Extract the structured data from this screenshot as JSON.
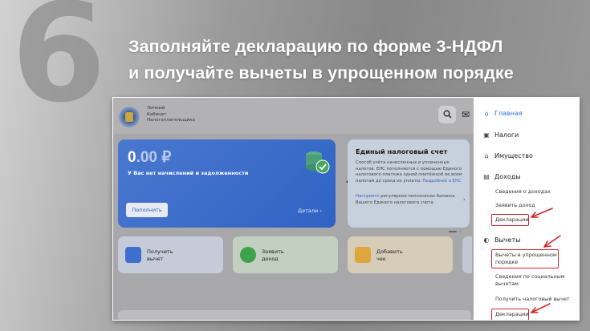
{
  "slide": {
    "number": "6",
    "headline_line1": "Заполняйте декларацию по форме 3-НДФЛ",
    "headline_line2": "и получайте вычеты в упрощенном порядке"
  },
  "header": {
    "cabinet_line1": "Личный",
    "cabinet_line2": "Кабинет",
    "cabinet_line3": "Налогоплательщика",
    "search_icon": "search-icon",
    "mail_icon": "mail-icon"
  },
  "balance": {
    "amount_int": "0",
    "amount_dec": ".00 ₽",
    "status": "У Вас нет начислений и задолженности",
    "pay_label": "Пополнить",
    "details_label": "Детали"
  },
  "ens": {
    "title": "Единый налоговый счет",
    "description": "Способ учёта начисленных и уплаченных налогов. ЕНС пополняется с помощью Единого налогового платежа одной платёжкой во всем налогам до срока их уплаты. ",
    "more_link": "Подробнее о ЕНС",
    "setup_link": "Настроите",
    "setup_text": " регулярное пополнение баланса Вашего Единого налогового счета."
  },
  "actions": [
    {
      "line1": "Получить",
      "line2": "вычет",
      "color": "#c6cbd9",
      "icon_color": "#3d6fce"
    },
    {
      "line1": "Заявить",
      "line2": "доход",
      "color": "#c3d0c1",
      "icon_color": "#3fa14b"
    },
    {
      "line1": "Добавить",
      "line2": "чек",
      "color": "#d6cdb9",
      "icon_color": "#e1a63b"
    }
  ],
  "sidebar": {
    "home": "Главная",
    "taxes": "Налоги",
    "property": "Имущество",
    "income": "Доходы",
    "income_sub": [
      "Сведения о доходах",
      "Заявить доход",
      "Декларации"
    ],
    "deductions": "Вычеты",
    "deductions_sub": [
      "Вычеты в упрощенном",
      "порядке",
      "Сведения по социальным",
      "вычетам",
      "Получить налоговый вычет",
      "Декларации"
    ]
  },
  "colors": {
    "accent": "#2c6bd8",
    "highlight": "#d4252a"
  }
}
